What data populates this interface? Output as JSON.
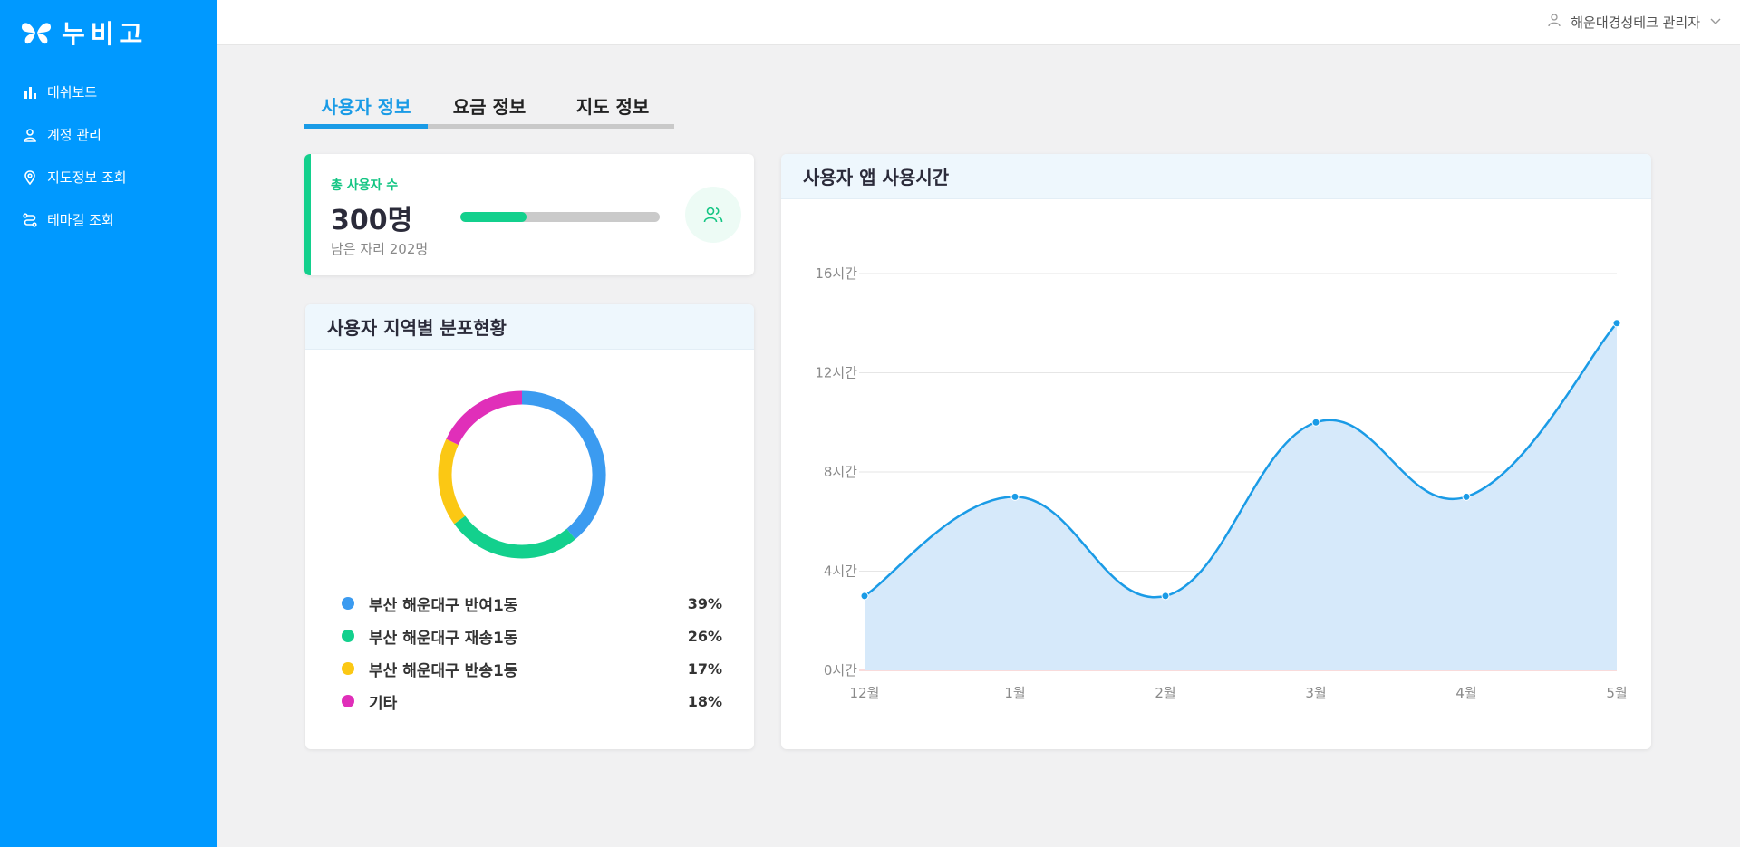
{
  "app": {
    "logo_text": "누비고"
  },
  "sidebar": {
    "items": [
      {
        "label": "대쉬보드",
        "icon": "bar-chart-icon"
      },
      {
        "label": "계정 관리",
        "icon": "user-icon"
      },
      {
        "label": "지도정보 조회",
        "icon": "map-pin-icon"
      },
      {
        "label": "테마길 조회",
        "icon": "route-icon"
      }
    ]
  },
  "header": {
    "user_name": "해운대경성테크 관리자"
  },
  "tabs": [
    {
      "label": "사용자 정보",
      "active": true
    },
    {
      "label": "요금 정보",
      "active": false
    },
    {
      "label": "지도 정보",
      "active": false
    }
  ],
  "users_card": {
    "label": "총 사용자 수",
    "value": "300명",
    "sub": "남은 자리 202명",
    "progress": 0.33
  },
  "distribution": {
    "title": "사용자 지역별 분포현황",
    "items": [
      {
        "label": "부산 해운대구 반여1동",
        "pct": "39%",
        "value": 39,
        "color": "#3b9bf0"
      },
      {
        "label": "부산 해운대구 재송1동",
        "pct": "26%",
        "value": 26,
        "color": "#13d08d"
      },
      {
        "label": "부산 해운대구 반송1동",
        "pct": "17%",
        "value": 17,
        "color": "#fbc814"
      },
      {
        "label": "기타",
        "pct": "18%",
        "value": 18,
        "color": "#e02fb9"
      }
    ]
  },
  "usage_chart": {
    "title": "사용자 앱 사용시간"
  },
  "chart_data": {
    "type": "area",
    "title": "사용자 앱 사용시간",
    "categories": [
      "12월",
      "1월",
      "2월",
      "3월",
      "4월",
      "5월"
    ],
    "values": [
      3,
      7,
      3,
      10,
      7,
      14
    ],
    "ylim": [
      0,
      16
    ],
    "yticks": [
      0,
      4,
      8,
      12,
      16
    ],
    "ytick_labels": [
      "0시간",
      "4시간",
      "8시간",
      "12시간",
      "16시간"
    ],
    "line_color": "#1a9be6",
    "fill_color": "#d6e9fa",
    "grid": true
  }
}
